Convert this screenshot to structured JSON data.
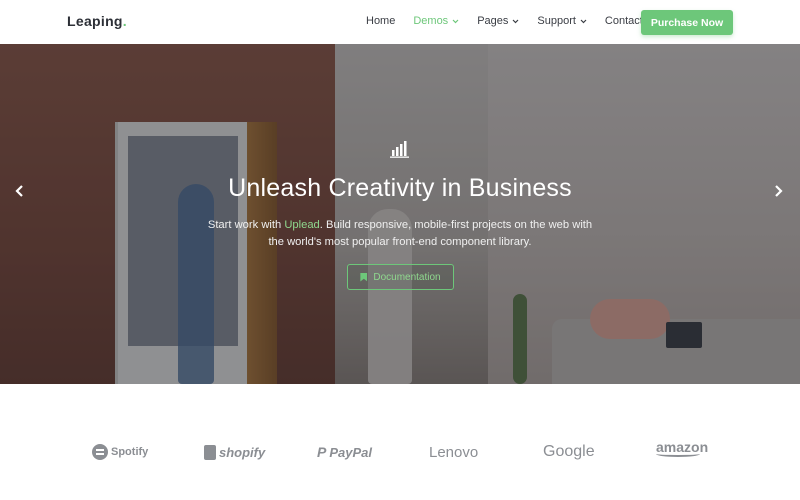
{
  "brand": {
    "name": "Leaping",
    "dot": "."
  },
  "nav": {
    "items": [
      {
        "label": "Home",
        "has_caret": false,
        "active": false
      },
      {
        "label": "Demos",
        "has_caret": true,
        "active": true
      },
      {
        "label": "Pages",
        "has_caret": true,
        "active": false
      },
      {
        "label": "Support",
        "has_caret": true,
        "active": false
      },
      {
        "label": "Contact",
        "has_caret": false,
        "active": false
      }
    ],
    "cta_label": "Purchase Now"
  },
  "hero": {
    "icon": "bar-chart-icon",
    "headline": "Unleash Creativity in Business",
    "sub_before": "Start work with ",
    "sub_highlight": "Uplead",
    "sub_after": ". Build responsive, mobile-first projects on the web with the world's most popular front-end component library.",
    "button_label": "Documentation",
    "prev_icon": "chevron-left-icon",
    "next_icon": "chevron-right-icon"
  },
  "logos": {
    "items": [
      "Spotify",
      "shopify",
      "PayPal",
      "Lenovo",
      "Google",
      "amazon"
    ]
  },
  "colors": {
    "accent": "#6dc77a",
    "text_dark": "#2c2f36",
    "logo_gray": "#8b8e93"
  }
}
